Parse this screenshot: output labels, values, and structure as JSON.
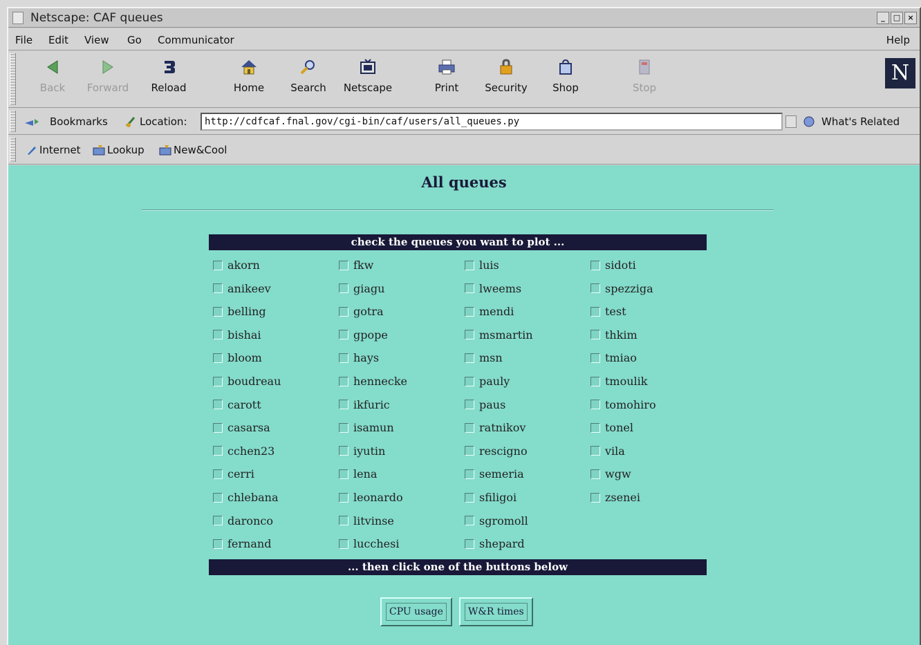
{
  "window": {
    "title": "Netscape: CAF queues",
    "controls": [
      "_",
      "□",
      "×"
    ]
  },
  "menu": {
    "items": [
      "File",
      "Edit",
      "View",
      "Go",
      "Communicator"
    ],
    "help": "Help"
  },
  "nav": {
    "back": "Back",
    "forward": "Forward",
    "reload": "Reload",
    "home": "Home",
    "search": "Search",
    "netscape": "Netscape",
    "print": "Print",
    "security": "Security",
    "shop": "Shop",
    "stop": "Stop"
  },
  "location": {
    "bookmarks": "Bookmarks",
    "label": "Location:",
    "url": "http://cdfcaf.fnal.gov/cgi-bin/caf/users/all_queues.py",
    "whats_related": "What's Related"
  },
  "personal": {
    "items": [
      "Internet",
      "Lookup",
      "New&Cool"
    ]
  },
  "page": {
    "title": "All queues",
    "header": "check the queues you want to plot ...",
    "footer": "... then click one of the buttons below",
    "queues": [
      [
        "akorn",
        "anikeev",
        "belling",
        "bishai",
        "bloom",
        "boudreau",
        "carott",
        "casarsa",
        "cchen23",
        "cerri",
        "chlebana",
        "daronco",
        "fernand"
      ],
      [
        "fkw",
        "giagu",
        "gotra",
        "gpope",
        "hays",
        "hennecke",
        "ikfuric",
        "isamun",
        "iyutin",
        "lena",
        "leonardo",
        "litvinse",
        "lucchesi"
      ],
      [
        "luis",
        "lweems",
        "mendi",
        "msmartin",
        "msn",
        "pauly",
        "paus",
        "ratnikov",
        "rescigno",
        "semeria",
        "sfiligoi",
        "sgromoll",
        "shepard"
      ],
      [
        "sidoti",
        "spezziga",
        "test",
        "thkim",
        "tmiao",
        "tmoulik",
        "tomohiro",
        "tonel",
        "vila",
        "wgw",
        "zsenei"
      ]
    ],
    "buttons": {
      "cpu": "CPU usage",
      "wr": "W&R times"
    }
  }
}
